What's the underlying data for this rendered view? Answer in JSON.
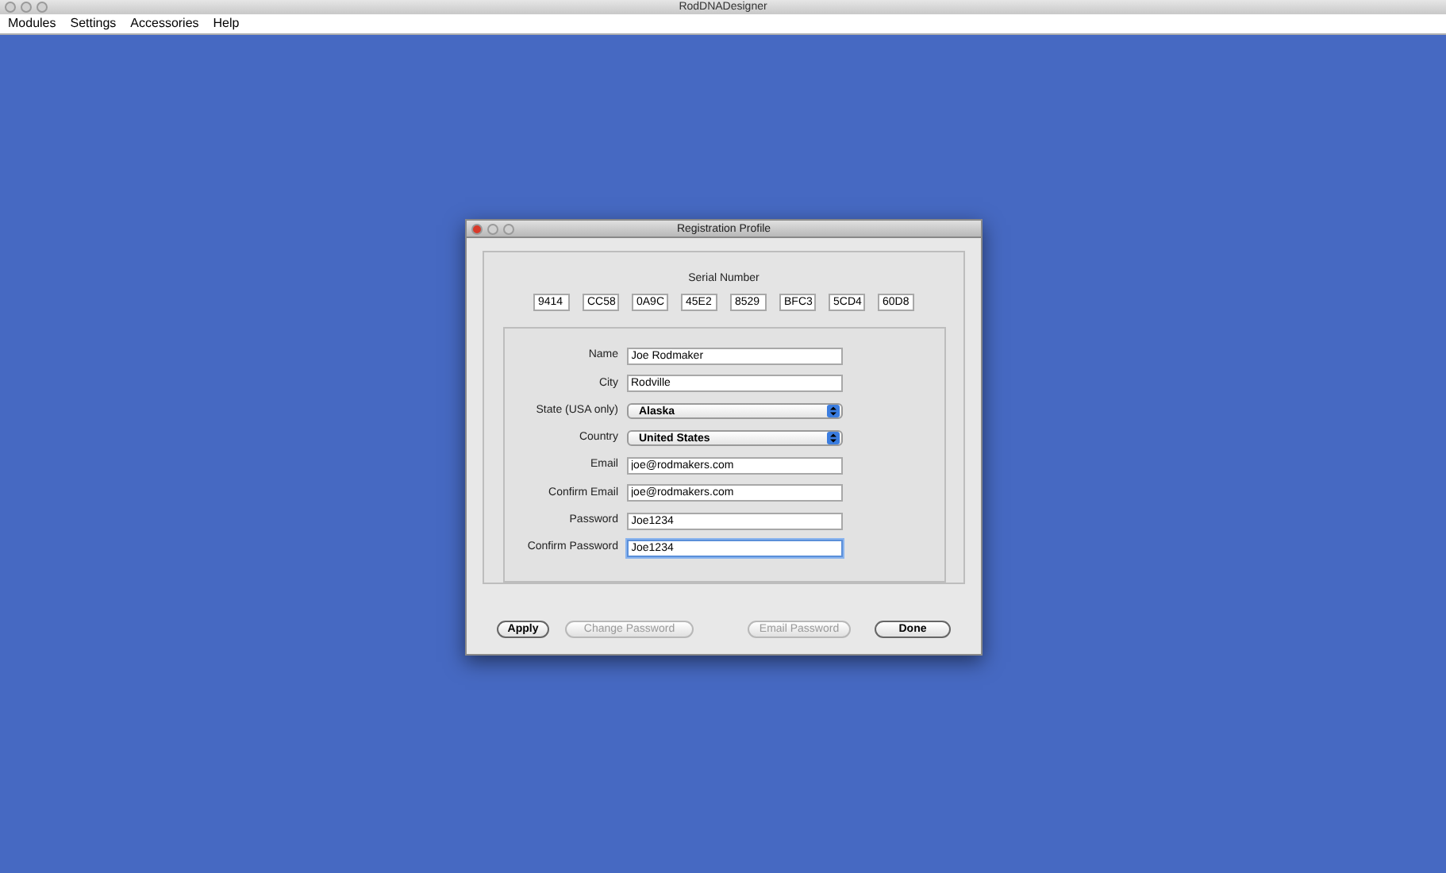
{
  "window": {
    "title": "RodDNADesigner"
  },
  "menu": [
    "Modules",
    "Settings",
    "Accessories",
    "Help"
  ],
  "dialog": {
    "title": "Registration Profile",
    "serial_label": "Serial Number",
    "serial": [
      "9414",
      "CC58",
      "0A9C",
      "45E2",
      "8529",
      "BFC3",
      "5CD4",
      "60D8"
    ],
    "fields": [
      {
        "label": "Name",
        "kind": "text",
        "value": "Joe Rodmaker",
        "selected": false
      },
      {
        "label": "City",
        "kind": "text",
        "value": "Rodville",
        "selected": false
      },
      {
        "label": "State (USA only)",
        "kind": "select",
        "value": "Alaska",
        "selected": false
      },
      {
        "label": "Country",
        "kind": "select",
        "value": "United States",
        "selected": false
      },
      {
        "label": "Email",
        "kind": "text",
        "value": "joe@rodmakers.com",
        "selected": false
      },
      {
        "label": "Confirm Email",
        "kind": "text",
        "value": "joe@rodmakers.com",
        "selected": false
      },
      {
        "label": "Password",
        "kind": "text",
        "value": "Joe1234",
        "selected": false
      },
      {
        "label": "Confirm Password",
        "kind": "text",
        "value": "Joe1234",
        "selected": true
      }
    ],
    "buttons": [
      {
        "label": "Apply",
        "disabled": false
      },
      {
        "label": "Change Password",
        "disabled": true
      },
      {
        "label": "Email Password",
        "disabled": true
      },
      {
        "label": "Done",
        "disabled": false
      }
    ]
  }
}
